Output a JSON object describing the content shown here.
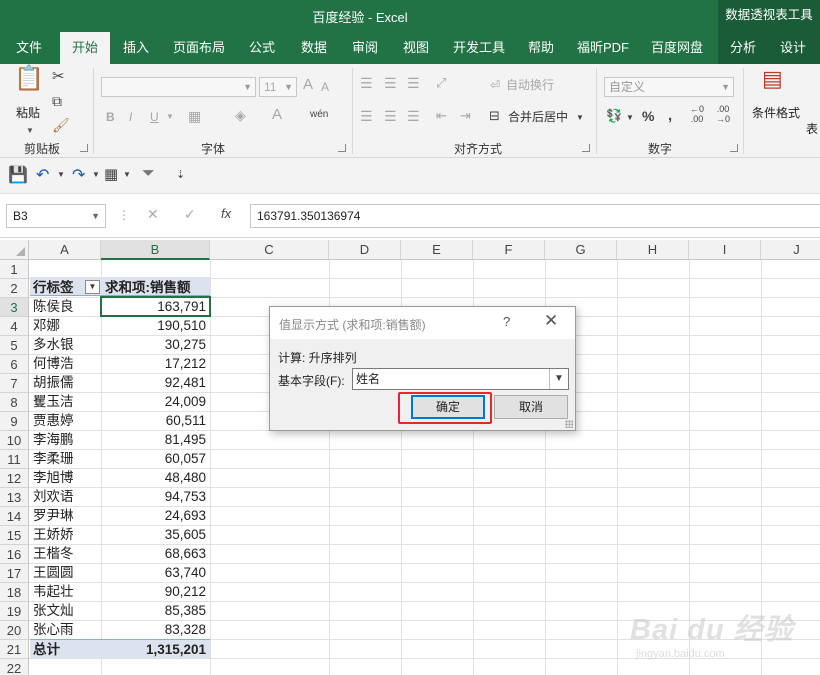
{
  "window": {
    "title": "百度经验  -  Excel",
    "context_tab": "数据透视表工具"
  },
  "tabs": [
    "文件",
    "开始",
    "插入",
    "页面布局",
    "公式",
    "数据",
    "审阅",
    "视图",
    "开发工具",
    "帮助",
    "福昕PDF",
    "百度网盘",
    "分析",
    "设计"
  ],
  "active_tab": "开始",
  "ribbon": {
    "paste_label": "粘贴",
    "groups": [
      "剪贴板",
      "字体",
      "对齐方式",
      "数字"
    ],
    "font_size": "11",
    "bold": "B",
    "italic": "I",
    "underline": "U",
    "wrap_text": "自动换行",
    "merge_center": "合并后居中",
    "number_format": "自定义",
    "conditional_format": "条件格式",
    "table_format_partial": "表"
  },
  "formula_bar": {
    "name_box": "B3",
    "formula": "163791.350136974",
    "fx": "fx"
  },
  "sheet": {
    "columns": [
      "A",
      "B",
      "C",
      "D",
      "E",
      "F",
      "G",
      "H",
      "I",
      "J"
    ],
    "rows": [
      "1",
      "2",
      "3",
      "4",
      "5",
      "6",
      "7",
      "8",
      "9",
      "10",
      "11",
      "12",
      "13",
      "14",
      "15",
      "16",
      "17",
      "18",
      "19",
      "20",
      "21",
      "22"
    ],
    "header": {
      "a": "行标签",
      "b": "求和项:销售额"
    },
    "data": [
      {
        "name": "陈侯良",
        "value": "163,791"
      },
      {
        "name": "邓娜",
        "value": "190,510"
      },
      {
        "name": "多水银",
        "value": "30,275"
      },
      {
        "name": "何博浩",
        "value": "17,212"
      },
      {
        "name": "胡振儒",
        "value": "92,481"
      },
      {
        "name": "矍玉洁",
        "value": "24,009"
      },
      {
        "name": "贾惠婷",
        "value": "60,511"
      },
      {
        "name": "李海鹏",
        "value": "81,495"
      },
      {
        "name": "李柔珊",
        "value": "60,057"
      },
      {
        "name": "李旭博",
        "value": "48,480"
      },
      {
        "name": "刘欢语",
        "value": "94,753"
      },
      {
        "name": "罗尹琳",
        "value": "24,693"
      },
      {
        "name": "王娇娇",
        "value": "35,605"
      },
      {
        "name": "王楷冬",
        "value": "68,663"
      },
      {
        "name": "王圆圆",
        "value": "63,740"
      },
      {
        "name": "韦起壮",
        "value": "90,212"
      },
      {
        "name": "张文灿",
        "value": "85,385"
      },
      {
        "name": "张心雨",
        "value": "83,328"
      }
    ],
    "total": {
      "a": "总计",
      "b": "1,315,201"
    }
  },
  "dialog": {
    "title": "值显示方式 (求和项:销售额)",
    "help": "?",
    "close": "✕",
    "calc_label": "计算: 升序排列",
    "base_field_label": "基本字段(F):",
    "base_field_value": "姓名",
    "ok": "确定",
    "cancel": "取消"
  },
  "watermark": {
    "brand": "Bai du 经验",
    "url": "jingyan.baidu.com"
  },
  "colors": {
    "excel_green": "#217346",
    "pivot_band": "#dde3ee",
    "highlight_red": "#e8262e"
  }
}
